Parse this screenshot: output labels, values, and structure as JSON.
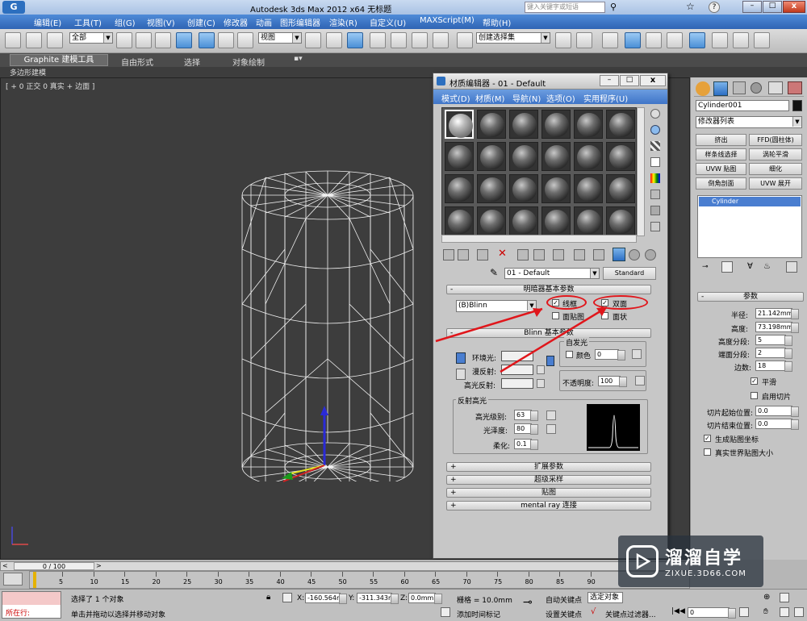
{
  "app": {
    "title": "Autodesk 3ds Max  2012 x64    无标题",
    "search_placeholder": "键入关键字或短语"
  },
  "menu": [
    "编辑(E)",
    "工具(T)",
    "组(G)",
    "视图(V)",
    "创建(C)",
    "修改器",
    "动画",
    "图形编辑器",
    "渲染(R)",
    "自定义(U)",
    "MAXScript(M)",
    "帮助(H)"
  ],
  "toolbar": {
    "selection_filter": "全部",
    "ref_coord": "视图",
    "named_selection": "创建选择集"
  },
  "ribbon": {
    "tabs": [
      "Graphite 建模工具",
      "自由形式",
      "选择",
      "对象绘制"
    ],
    "subtab": "多边形建模"
  },
  "viewport": {
    "label": "[ + 0 正交 0 真实 + 边面 ]"
  },
  "material_editor": {
    "title": "材质编辑器 - 01 - Default",
    "menu": [
      "模式(D)",
      "材质(M)",
      "导航(N)",
      "选项(O)",
      "实用程序(U)"
    ],
    "material_name": "01 - Default",
    "material_type": "Standard",
    "shader_rollout": "明暗器基本参数",
    "shader": "(B)Blinn",
    "opts": {
      "wire": "线框",
      "two_sided": "双面",
      "face_map": "面贴图",
      "faceted": "面状"
    },
    "blinn_rollout": "Blinn 基本参数",
    "self_illum": {
      "group": "自发光",
      "color_label": "颜色",
      "value": "0"
    },
    "ambient": "环境光:",
    "diffuse": "漫反射:",
    "specular": "高光反射:",
    "opacity_label": "不透明度:",
    "opacity": "100",
    "spec_highlights": "反射高光",
    "spec_level_label": "高光级别:",
    "spec_level": "63",
    "glossiness_label": "光泽度:",
    "glossiness": "80",
    "soften_label": "柔化:",
    "soften": "0.1",
    "rollouts": [
      "扩展参数",
      "超级采样",
      "贴图",
      "mental ray 连接"
    ]
  },
  "command_panel": {
    "object_name": "Cylinder001",
    "modifier_list": "修改器列表",
    "buttons": [
      "挤出",
      "FFD(圆柱体)",
      "样条线选择",
      "涡轮平滑",
      "UVW 贴图",
      "细化",
      "倒角剖面",
      "UVW 展开"
    ],
    "stack_item": "Cylinder",
    "params_title": "参数",
    "radius_label": "半径:",
    "radius": "21.142mm",
    "height_label": "高度:",
    "height": "73.198mm",
    "height_segs_label": "高度分段:",
    "height_segs": "5",
    "cap_segs_label": "端面分段:",
    "cap_segs": "2",
    "sides_label": "边数:",
    "sides": "18",
    "smooth": "平滑",
    "slice_on": "启用切片",
    "slice_from_label": "切片起始位置:",
    "slice_from": "0.0",
    "slice_to_label": "切片结束位置:",
    "slice_to": "0.0",
    "gen_map": "生成贴图坐标",
    "real_world": "真实世界贴图大小"
  },
  "timeline": {
    "frame": "0 / 100",
    "ticks": [
      "5",
      "10",
      "15",
      "20",
      "25",
      "30",
      "35",
      "40",
      "45",
      "50",
      "55",
      "60",
      "65",
      "70",
      "75",
      "80",
      "85",
      "90"
    ]
  },
  "status": {
    "in_scene": "所在行:",
    "selected": "选择了 1 个对象",
    "prompt": "单击并拖动以选择并移动对象",
    "x": "-160.564m",
    "y": "-311.343m",
    "z": "0.0mm",
    "grid": "栅格 = 10.0mm",
    "add_time_tag": "添加时间标记",
    "auto_key": "自动关键点",
    "set_key": "设置关键点",
    "selected_obj": "选定对象",
    "key_filter": "关键点过滤器...",
    "frame_value": "0"
  },
  "watermark": {
    "brand": "溜溜自学",
    "url": "ZIXUE.3D66.COM"
  }
}
